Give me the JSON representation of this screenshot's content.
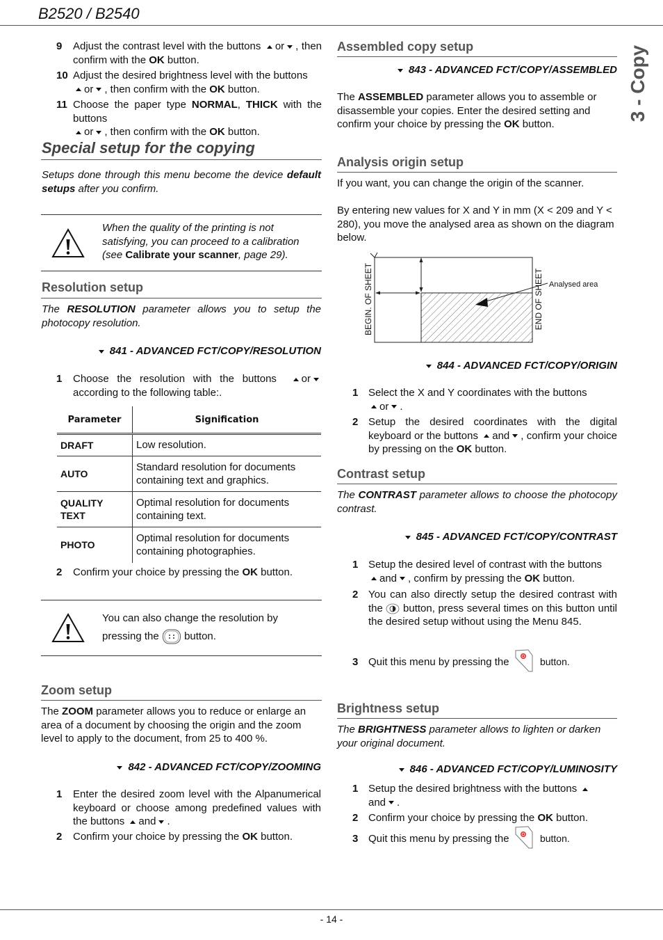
{
  "header": {
    "title": "B2520 / B2540"
  },
  "side_tab": {
    "label": "3 - Copy"
  },
  "footer": {
    "page": "- 14 -"
  },
  "left": {
    "steps_top": [
      {
        "num": "9",
        "parts": [
          "Adjust the contrast level with the buttons",
          "or",
          ",",
          "then confirm with the",
          "OK",
          "button."
        ]
      },
      {
        "num": "10",
        "parts": [
          "Adjust the desired brightness level with the buttons",
          "or",
          ", then confirm with the",
          "OK",
          "button."
        ]
      },
      {
        "num": "11",
        "parts": [
          "Choose the paper type",
          "NORMAL",
          ",",
          "THICK",
          "with the buttons",
          "or",
          ", then confirm with the",
          "OK",
          "button."
        ]
      }
    ],
    "special": {
      "title": "Special setup for the copying",
      "intro_a": "Setups done through this menu become the device",
      "intro_b": "default setups",
      "intro_c": "after you confirm."
    },
    "note1": {
      "icon": "warning-icon",
      "text_a": "When the quality of the printing is not satisfying, you can proceed to a calibration (see",
      "text_b": "Calibrate your scanner",
      "text_c": ", page 29)."
    },
    "resolution": {
      "title": "Resolution setup",
      "intro_a": "The",
      "intro_b": "RESOLUTION",
      "intro_c": "parameter allows you to setup the photocopy resolution.",
      "menu": "841 - ADVANCED FCT/COPY/RESOLUTION",
      "step1_num": "1",
      "step1_a": "Choose the resolution with the buttons",
      "step1_b": "or",
      "step1_c": "according to the following table:.",
      "table": {
        "headers": [
          "Parameter",
          "Signification"
        ],
        "rows": [
          {
            "param": "DRAFT",
            "sig": "Low resolution."
          },
          {
            "param": "AUTO",
            "sig": "Standard resolution for documents containing text and graphics."
          },
          {
            "param": "QUALITY TEXT",
            "sig": "Optimal resolution for documents containing text."
          },
          {
            "param": "PHOTO",
            "sig": "Optimal resolution for documents containing photographies."
          }
        ]
      },
      "step2_num": "2",
      "step2_a": "Confirm your choice by pressing the",
      "step2_b": "OK",
      "step2_c": "button."
    },
    "note2": {
      "icon": "warning-icon",
      "text_a": "You can also change the resolution by",
      "text_b": "pressing the",
      "button_icon": "resolution-button-icon",
      "text_c": "button."
    },
    "zoom": {
      "title": "Zoom setup",
      "intro_a": "The",
      "intro_b": "ZOOM",
      "intro_c": "parameter allows you to reduce or enlarge an area of a document by choosing the origin and the zoom level to apply to the document, from 25 to 400 %.",
      "menu": "842 - ADVANCED FCT/COPY/ZOOMING",
      "step1_num": "1",
      "step1_a": "Enter the desired zoom level with the Alpanumerical keyboard or choose among predefined values with the buttons",
      "step1_b": "and",
      "step1_c": ".",
      "step2_num": "2",
      "step2_a": "Confirm your choice by pressing the",
      "step2_b": "OK",
      "step2_c": "button."
    }
  },
  "right": {
    "assembled": {
      "title": "Assembled copy setup",
      "menu": "843 - ADVANCED FCT/COPY/ASSEMBLED",
      "text_a": "The",
      "text_b": "ASSEMBLED",
      "text_c": "parameter allows you to assemble or disassemble your copies. Enter the desired setting and confirm your choice by pressing the",
      "text_d": "OK",
      "text_e": "button."
    },
    "origin": {
      "title": "Analysis origin setup",
      "p1": "If you want, you can change the origin of the scanner.",
      "p2": "By entering new values for X and Y in mm (X < 209 and Y < 280), you move the analysed area as shown on the diagram below.",
      "diagram": {
        "left_label": "BEGIN. OF SHEET",
        "right_label": "END OF SHEET",
        "area_label": "Analysed area"
      },
      "menu": "844 - ADVANCED FCT/COPY/ORIGIN",
      "step1_num": "1",
      "step1_a": "Select the X and Y coordinates with the buttons",
      "step1_b": "or",
      "step1_c": ".",
      "step2_num": "2",
      "step2_a": "Setup the desired coordinates with the digital keyboard or the buttons",
      "step2_b": "and",
      "step2_c": ", confirm your choice by pressing on the",
      "step2_d": "OK",
      "step2_e": "button."
    },
    "contrast": {
      "title": "Contrast setup",
      "intro_a": "The",
      "intro_b": "CONTRAST",
      "intro_c": "parameter allows to choose the photocopy contrast.",
      "menu": "845 - ADVANCED FCT/COPY/CONTRAST",
      "step1_num": "1",
      "step1_a": "Setup the desired level of contrast with the buttons",
      "step1_b": "and",
      "step1_c": ", confirm by pressing the",
      "step1_d": "OK",
      "step1_e": "button.",
      "step2_num": "2",
      "step2_a": "You can also directly setup the desired contrast with the",
      "step2_icon": "contrast-button-icon",
      "step2_b": "button, press several times on this button until the desired setup without using the Menu 845.",
      "step3_num": "3",
      "step3_a": "Quit this menu by pressing the",
      "step3_icon": "stop-button-icon",
      "step3_b": "button."
    },
    "brightness": {
      "title": "Brightness setup",
      "intro_a": "The",
      "intro_b": "BRIGHTNESS",
      "intro_c": "parameter allows to lighten or darken your original document.",
      "menu": "846 - ADVANCED FCT/COPY/LUMINOSITY",
      "step1_num": "1",
      "step1_a": "Setup the desired brightness with the buttons",
      "step1_b": "and",
      "step1_c": ".",
      "step2_num": "2",
      "step2_a": "Confirm your choice by pressing the",
      "step2_b": "OK",
      "step2_c": "button.",
      "step3_num": "3",
      "step3_a": "Quit this menu by pressing the",
      "step3_icon": "stop-button-icon",
      "step3_b": "button."
    }
  },
  "colors": {
    "heading_gray": "#555555",
    "stop_red": "#e03030"
  }
}
